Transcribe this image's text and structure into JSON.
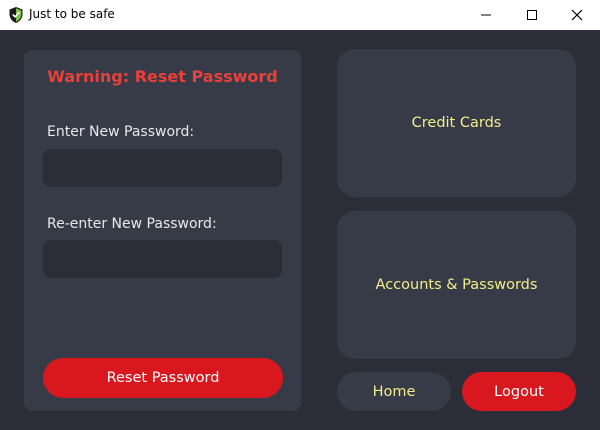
{
  "window": {
    "title": "Just to be safe",
    "app_icon": "shield-check-icon",
    "controls": [
      "minimize-icon",
      "maximize-icon",
      "close-icon"
    ]
  },
  "reset_panel": {
    "title": "Warning: Reset Password",
    "new_password_label": "Enter New Password:",
    "new_password_value": "",
    "confirm_password_label": "Re-enter New Password:",
    "confirm_password_value": "",
    "reset_button_label": "Reset Password"
  },
  "nav": {
    "credit_cards_label": "Credit Cards",
    "accounts_label": "Accounts & Passwords",
    "home_label": "Home",
    "logout_label": "Logout"
  },
  "colors": {
    "background": "#2b2e38",
    "panel": "#373b47",
    "warning_text": "#e8403a",
    "danger_button": "#d8181e",
    "tile_text": "#f3ed8a"
  }
}
